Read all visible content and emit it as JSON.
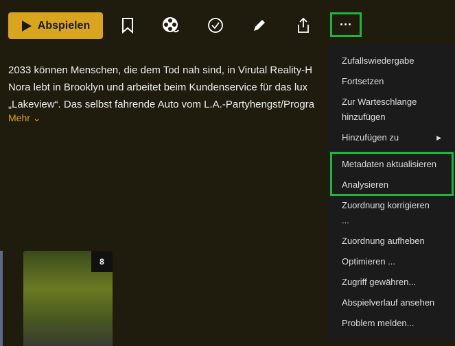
{
  "toolbar": {
    "play_label": "Abspielen",
    "more_label": "···"
  },
  "description": {
    "lines": [
      "2033 können Menschen, die dem Tod nah sind, in Virutal Reality-H",
      "Nora lebt in Brooklyn und arbeitet beim Kundenservice für das lux",
      "„Lakeview“. Das selbst fahrende Auto vom L.A.-Partyhengst/Progra"
    ],
    "more_label": "Mehr"
  },
  "menu": {
    "items": [
      "Zufallswiedergabe",
      "Fortsetzen",
      "Zur Warteschlange hinzufügen",
      "Hinzufügen zu",
      "Metadaten aktualisieren",
      "Analysieren",
      "Zuordnung korrigieren ...",
      "Zuordnung aufheben",
      "Optimieren ...",
      "Zugriff gewähren...",
      "Abspielverlauf ansehen",
      "Problem melden..."
    ]
  },
  "poster": {
    "badge": "8"
  }
}
